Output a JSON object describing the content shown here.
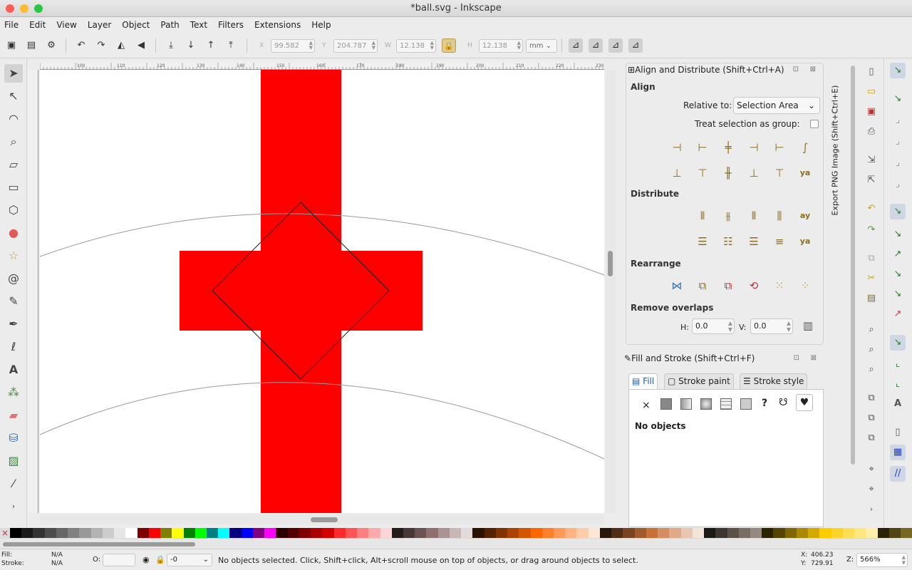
{
  "window": {
    "title": "*ball.svg - Inkscape",
    "traffic": [
      "#fd5f57",
      "#febb2e",
      "#28c840"
    ]
  },
  "menu": [
    "File",
    "Edit",
    "View",
    "Layer",
    "Object",
    "Path",
    "Text",
    "Filters",
    "Extensions",
    "Help"
  ],
  "toolbar": {
    "x_label": "X",
    "x_value": "99.582",
    "y_label": "Y",
    "y_value": "204.787",
    "w_label": "W",
    "w_value": "12.138",
    "h_label": "H",
    "h_value": "12.138",
    "unit": "mm"
  },
  "align": {
    "title": "Align and Distribute (Shift+Ctrl+A)",
    "align_head": "Align",
    "relative_label": "Relative to:",
    "relative_value": "Selection Area",
    "treat_group": "Treat selection as group:",
    "distribute_head": "Distribute",
    "rearrange_head": "Rearrange",
    "overlap_head": "Remove overlaps",
    "h_label": "H:",
    "h_value": "0.0",
    "v_label": "V:",
    "v_value": "0.0"
  },
  "export_tab": "Export PNG Image (Shift+Ctrl+E)",
  "fill": {
    "title": "Fill and Stroke (Shift+Ctrl+F)",
    "tabs": [
      "Fill",
      "Stroke paint",
      "Stroke style"
    ],
    "no_objects": "No objects",
    "unknown_glyph": "?"
  },
  "status": {
    "fill_label": "Fill:",
    "fill_value": "N/A",
    "stroke_label": "Stroke:",
    "stroke_value": "N/A",
    "opacity_label": "O:",
    "layer_value": "-0",
    "message": "No objects selected. Click, Shift+click, Alt+scroll mouse on top of objects, or drag around objects to select.",
    "x_label": "X:",
    "x_value": "406.23",
    "y_label": "Y:",
    "y_value": "729.91",
    "z_label": "Z:",
    "zoom": "566%"
  },
  "ruler_ticks": [
    "100",
    "110",
    "120",
    "130",
    "140",
    "150",
    "160",
    "170",
    "180",
    "190",
    "200",
    "210",
    "220",
    "230",
    "240"
  ],
  "colors": {
    "accent_red": "#ff0000",
    "canvas": "#ffffff",
    "chrome": "#ececec"
  },
  "icons": {
    "close": "×",
    "fill_text": "A"
  }
}
